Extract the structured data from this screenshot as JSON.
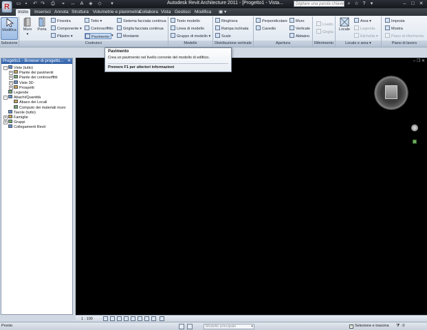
{
  "title_bar": {
    "app_button_glyph": "R",
    "title": "Autodesk Revit Architecture 2011 - [Progetto1 - Vista...",
    "search_placeholder": "Digitare una parola chiave o una fr...",
    "quick_access_icons": [
      "open-icon",
      "save-icon",
      "undo-icon",
      "redo-icon",
      "print-icon",
      "measure-icon",
      "dimension-icon",
      "text-icon",
      "3d-view-icon",
      "section-icon"
    ],
    "right_icons": [
      "binoculars-icon",
      "star-icon",
      "help-icon",
      "minimize-icon",
      "maximize-icon",
      "close-icon"
    ]
  },
  "tabs": [
    "Inizio",
    "Inserisci",
    "Annota",
    "Struttura",
    "Volumetrie e planimetria",
    "Collabora",
    "Vista",
    "Gestisci",
    "Modifica"
  ],
  "active_tab": "Inizio",
  "ribbon": {
    "selezione": {
      "modifica": "Modifica",
      "panel": "Selezione"
    },
    "costruisci": {
      "panel": "Costruisci",
      "muro": "Muro",
      "porta": "Porta",
      "finestra": "Finestra",
      "componente": "Componente",
      "pilastro": "Pilastro",
      "tetto": "Tetto",
      "controsoffitto": "Controsoffitto",
      "pavimento": "Pavimento",
      "sistema_facciata": "Sistema facciata continua",
      "griglia_facciata": "Griglia facciata continua",
      "montante": "Montante"
    },
    "modello": {
      "panel": "Modello",
      "testo_modello": "Testo modello",
      "linea_modello": "Linea di modello",
      "gruppo_modello": "Gruppo di modello"
    },
    "distribuzione": {
      "panel": "Distribuzione verticale",
      "ringhiera": "Ringhiera",
      "rampa": "Rampa inclinata",
      "scale": "Scale"
    },
    "apertura": {
      "panel": "Apertura",
      "perpendicolare": "Perpendicolare",
      "cavedio": "Cavedio",
      "muro": "Muro",
      "verticale": "Verticale",
      "abbaino": "Abbaino"
    },
    "riferimento": {
      "panel": "Riferimento",
      "livello": "Livello",
      "griglia": "Griglia"
    },
    "locale_area": {
      "panel": "Locale e area",
      "locale": "Locale",
      "area": "Area",
      "legenda": "Legenda",
      "etichetta": "Etichetta"
    },
    "piano_lavoro": {
      "panel": "Piano di lavoro",
      "imposta": "Imposta",
      "mostra": "Mostra",
      "piano_riferimento": "Piano di riferimento"
    }
  },
  "tooltip": {
    "title": "Pavimento",
    "description": "Crea un pavimento nel livello corrente del modello di edificio.",
    "hint": "Premere F1 per ulteriori informazioni"
  },
  "project_browser": {
    "title": "Progetto1 - Browser di progetto...",
    "items": [
      {
        "label": "Viste (tutto)",
        "level": 0,
        "toggle": "-"
      },
      {
        "label": "Piante dei pavimenti",
        "level": 1,
        "toggle": "+"
      },
      {
        "label": "Piante dei controsoffitti",
        "level": 1,
        "toggle": "+"
      },
      {
        "label": "Viste 3D",
        "level": 1,
        "toggle": "+"
      },
      {
        "label": "Prospetti",
        "level": 1,
        "toggle": "+"
      },
      {
        "label": "Legende",
        "level": 0,
        "toggle": ""
      },
      {
        "label": "Abachi/Quantità",
        "level": 0,
        "toggle": "-"
      },
      {
        "label": "Abaco dei Locali",
        "level": 1,
        "toggle": ""
      },
      {
        "label": "Computo dei materiali muro",
        "level": 1,
        "toggle": ""
      },
      {
        "label": "Tavole (tutto)",
        "level": 0,
        "toggle": ""
      },
      {
        "label": "Famiglie",
        "level": 0,
        "toggle": "+"
      },
      {
        "label": "Gruppi",
        "level": 0,
        "toggle": "+"
      },
      {
        "label": "Collegamenti Revit",
        "level": 0,
        "toggle": ""
      }
    ]
  },
  "canvas": {
    "background": "#000000"
  },
  "view_bar": {
    "scale": "1 : 100"
  },
  "status_bar": {
    "status": "Pronto",
    "model": "Modello principale",
    "selection_label": "Selezione e trascina",
    "filter_count": ":0"
  }
}
